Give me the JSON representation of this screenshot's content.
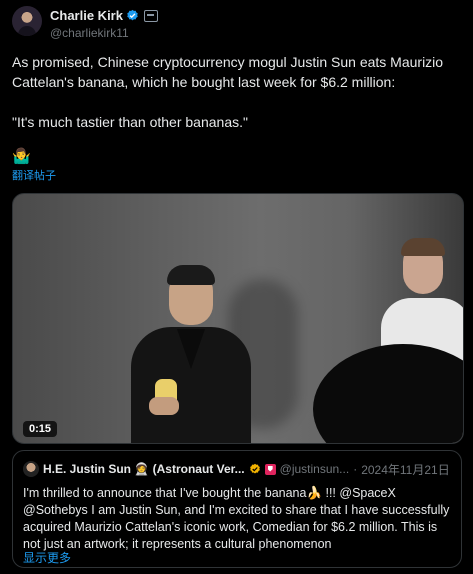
{
  "author": {
    "display_name": "Charlie Kirk",
    "handle": "@charliekirk11"
  },
  "tweet": {
    "text": "As promised, Chinese cryptocurrency mogul Justin Sun eats Maurizio Cattelan's banana, which he bought last week for $6.2 million:\n\n\"It's much tastier than other bananas.\"",
    "emoji": "🤷‍♂️",
    "translate_label": "翻译帖子"
  },
  "media": {
    "duration": "0:15"
  },
  "quoted": {
    "display_name": "H.E. Justin Sun 🧑‍🚀 (Astronaut Ver...",
    "handle": "@justinsun...",
    "separator": "·",
    "date": "2024年11月21日",
    "text": "I'm thrilled to announce that I've bought the banana🍌 !!! @SpaceX @Sothebys I am Justin Sun, and I'm excited to share that I have successfully acquired Maurizio Cattelan's iconic work, Comedian for $6.2 million. This is not just an artwork; it represents a cultural phenomenon",
    "show_more": "显示更多"
  },
  "colors": {
    "background": "#000000",
    "text": "#e7e9ea",
    "secondary": "#71767b",
    "accent": "#1d9bf0",
    "gold_badge": "#f2b200"
  }
}
